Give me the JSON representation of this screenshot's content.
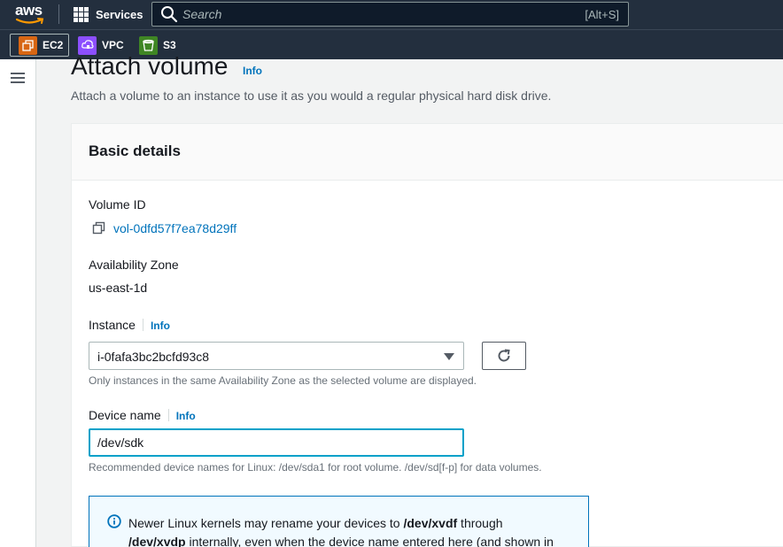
{
  "nav": {
    "logo_text": "aws",
    "services_label": "Services",
    "search_placeholder": "Search",
    "search_shortcut": "[Alt+S]"
  },
  "favorites": [
    {
      "label": "EC2",
      "icon": "ec2-icon",
      "color": "#d86613"
    },
    {
      "label": "VPC",
      "icon": "vpc-icon",
      "color": "#8c4fff"
    },
    {
      "label": "S3",
      "icon": "s3-icon",
      "color": "#3f8624"
    }
  ],
  "page": {
    "title": "Attach volume",
    "title_info": "Info",
    "description": "Attach a volume to an instance to use it as you would a regular physical hard disk drive."
  },
  "panel": {
    "header": "Basic details",
    "volume_id_label": "Volume ID",
    "volume_id_value": "vol-0dfd57f7ea78d29ff",
    "az_label": "Availability Zone",
    "az_value": "us-east-1d",
    "instance_label": "Instance",
    "instance_info": "Info",
    "instance_value": "i-0fafa3bc2bcfd93c8",
    "instance_hint": "Only instances in the same Availability Zone as the selected volume are displayed.",
    "device_label": "Device name",
    "device_info": "Info",
    "device_value": "/dev/sdk",
    "device_hint": "Recommended device names for Linux: /dev/sda1 for root volume. /dev/sd[f-p] for data volumes.",
    "alert_pre": "Newer Linux kernels may rename your devices to ",
    "alert_b1": "/dev/xvdf",
    "alert_mid": " through ",
    "alert_b2": "/dev/xvdp",
    "alert_post": " internally, even when the device name entered here (and shown in"
  },
  "colors": {
    "nav_bg": "#232f3e",
    "link": "#0073bb",
    "focus": "#00a1c9"
  }
}
